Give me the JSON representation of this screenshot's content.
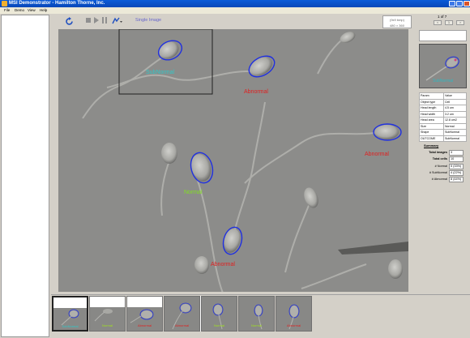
{
  "window": {
    "title": "MSI Demonstrator - Hamilton Thorne, Inc."
  },
  "menu": {
    "items": [
      "File",
      "Demo",
      "View",
      "Help"
    ]
  },
  "toolbar": {
    "mode_label": "Single Image",
    "info_line1": "(9x9 bmp)",
    "info_line2": "480 × 360"
  },
  "image": {
    "labels": [
      {
        "text": "SubNormal",
        "color": "#30c8c8"
      },
      {
        "text": "Abnormal",
        "color": "#e02020"
      },
      {
        "text": "Abnormal",
        "color": "#e02020"
      },
      {
        "text": "Normal",
        "color": "#80e020"
      },
      {
        "text": "Abnormal",
        "color": "#e02020"
      }
    ]
  },
  "right_panel": {
    "counter": "1 of 7",
    "current_thumb_label": "SubNormal",
    "table": {
      "headers": [
        "Param",
        "Value"
      ],
      "rows": [
        [
          "Object type",
          "Cell"
        ],
        [
          "Head length",
          "4.5 um"
        ],
        [
          "Head width",
          "3.2 um"
        ],
        [
          "Head area",
          "12.8 um2"
        ],
        [
          "Size",
          "Normal"
        ],
        [
          "Shape",
          "SubNormal"
        ],
        [
          "OUTCOME",
          "SubNormal"
        ]
      ]
    },
    "summary": {
      "title": "Summary",
      "rows": [
        {
          "label": "Total images",
          "value": "3",
          "bold": true
        },
        {
          "label": "Total cells",
          "value": "10",
          "bold": true
        },
        {
          "label": "# Normal",
          "value": "5  (33%)",
          "bold": false
        },
        {
          "label": "# SubNormal",
          "value": "4  (22%)",
          "bold": false
        },
        {
          "label": "# Abnormal",
          "value": "8  (44%)",
          "bold": false
        }
      ]
    }
  },
  "thumbnails": [
    {
      "label": "SubNormal",
      "color": "#30c8c8"
    },
    {
      "label": "Normal",
      "color": "#a0e020"
    },
    {
      "label": "Abnormal",
      "color": "#e02020"
    },
    {
      "label": "Abnormal",
      "color": "#e02020"
    },
    {
      "label": "Normal",
      "color": "#a0e020"
    },
    {
      "label": "Normal",
      "color": "#a0e020"
    },
    {
      "label": "Abnormal",
      "color": "#e02020"
    }
  ],
  "colors": {
    "outline": "#2030e0",
    "selection_box": "#202020"
  }
}
